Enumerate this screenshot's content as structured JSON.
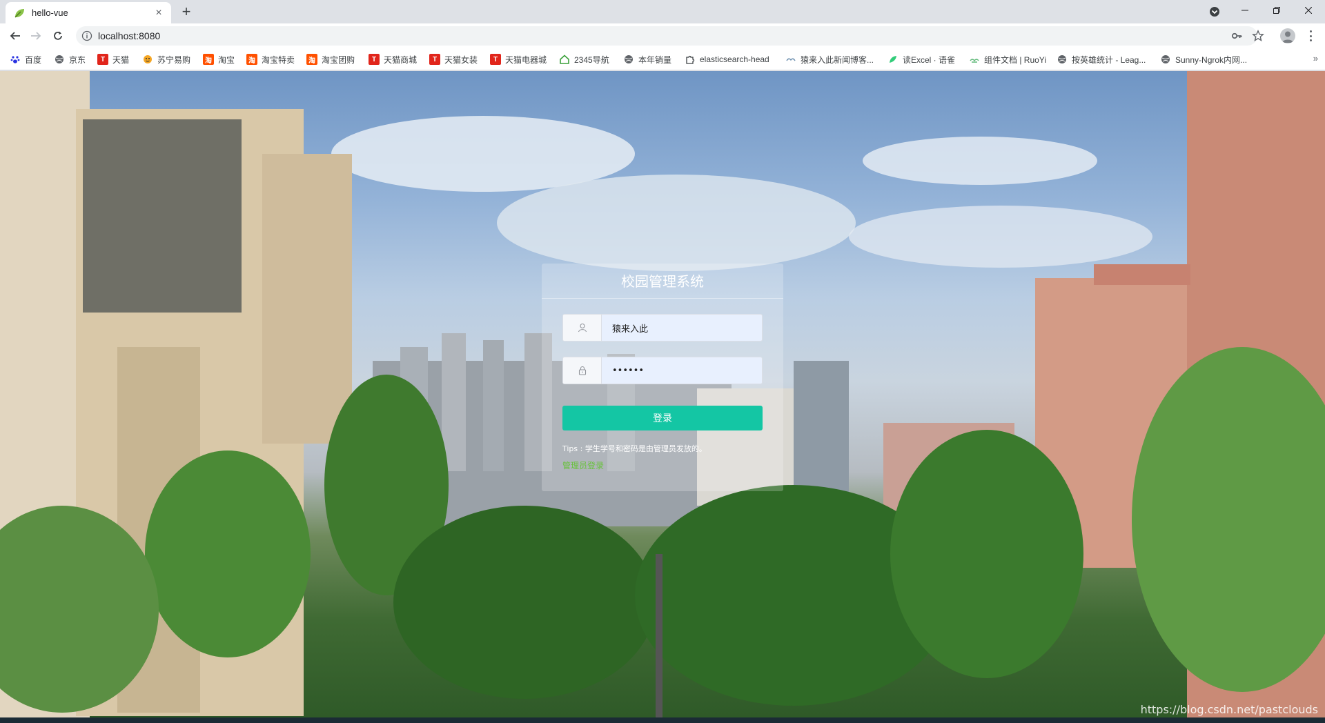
{
  "browser": {
    "tab": {
      "title": "hello-vue",
      "favicon": "leaf-icon"
    },
    "url": "localhost:8080",
    "colors": {
      "tabstrip": "#dee1e6",
      "toolbar": "#ffffff"
    }
  },
  "bookmarks": [
    {
      "label": "百度",
      "icon": "baidu-paw-icon",
      "color": "#2932e1"
    },
    {
      "label": "京东",
      "icon": "globe-icon",
      "color": "#5f6368"
    },
    {
      "label": "天猫",
      "icon": "tmall-icon",
      "color": "#e1251b"
    },
    {
      "label": "苏宁易购",
      "icon": "suning-icon",
      "color": "#f5a623"
    },
    {
      "label": "淘宝",
      "icon": "taobao-icon",
      "color": "#ff5000"
    },
    {
      "label": "淘宝特卖",
      "icon": "taobao-icon",
      "color": "#ff5000"
    },
    {
      "label": "淘宝团购",
      "icon": "taobao-icon",
      "color": "#ff5000"
    },
    {
      "label": "天猫商城",
      "icon": "tmall-icon",
      "color": "#e1251b"
    },
    {
      "label": "天猫女装",
      "icon": "tmall-icon",
      "color": "#e1251b"
    },
    {
      "label": "天猫电器城",
      "icon": "tmall-icon",
      "color": "#e1251b"
    },
    {
      "label": "2345导航",
      "icon": "house-icon",
      "color": "#3aa03a"
    },
    {
      "label": "本年销量",
      "icon": "globe-icon",
      "color": "#5f6368"
    },
    {
      "label": "elasticsearch-head",
      "icon": "puzzle-icon",
      "color": "#5f6368"
    },
    {
      "label": "猿来入此新闻博客...",
      "icon": "bird-icon",
      "color": "#5f6368"
    },
    {
      "label": "读Excel · 语雀",
      "icon": "yuque-icon",
      "color": "#31cc79"
    },
    {
      "label": "组件文档 | RuoYi",
      "icon": "ruoyi-icon",
      "color": "#5fb878"
    },
    {
      "label": "按英雄统计 - Leag...",
      "icon": "globe-icon",
      "color": "#5f6368"
    },
    {
      "label": "Sunny-Ngrok内网...",
      "icon": "globe-icon",
      "color": "#5f6368"
    }
  ],
  "bookmarks_overflow": "»",
  "login": {
    "title": "校园管理系统",
    "username_value": "猿来入此",
    "password_value": "••••••",
    "submit_label": "登录",
    "tips": "Tips : 学生学号和密码是由管理员发放的。",
    "admin_link": "管理员登录",
    "colors": {
      "button": "#14c6a4",
      "link": "#67c23a"
    }
  },
  "watermark": "https://blog.csdn.net/pastclouds"
}
